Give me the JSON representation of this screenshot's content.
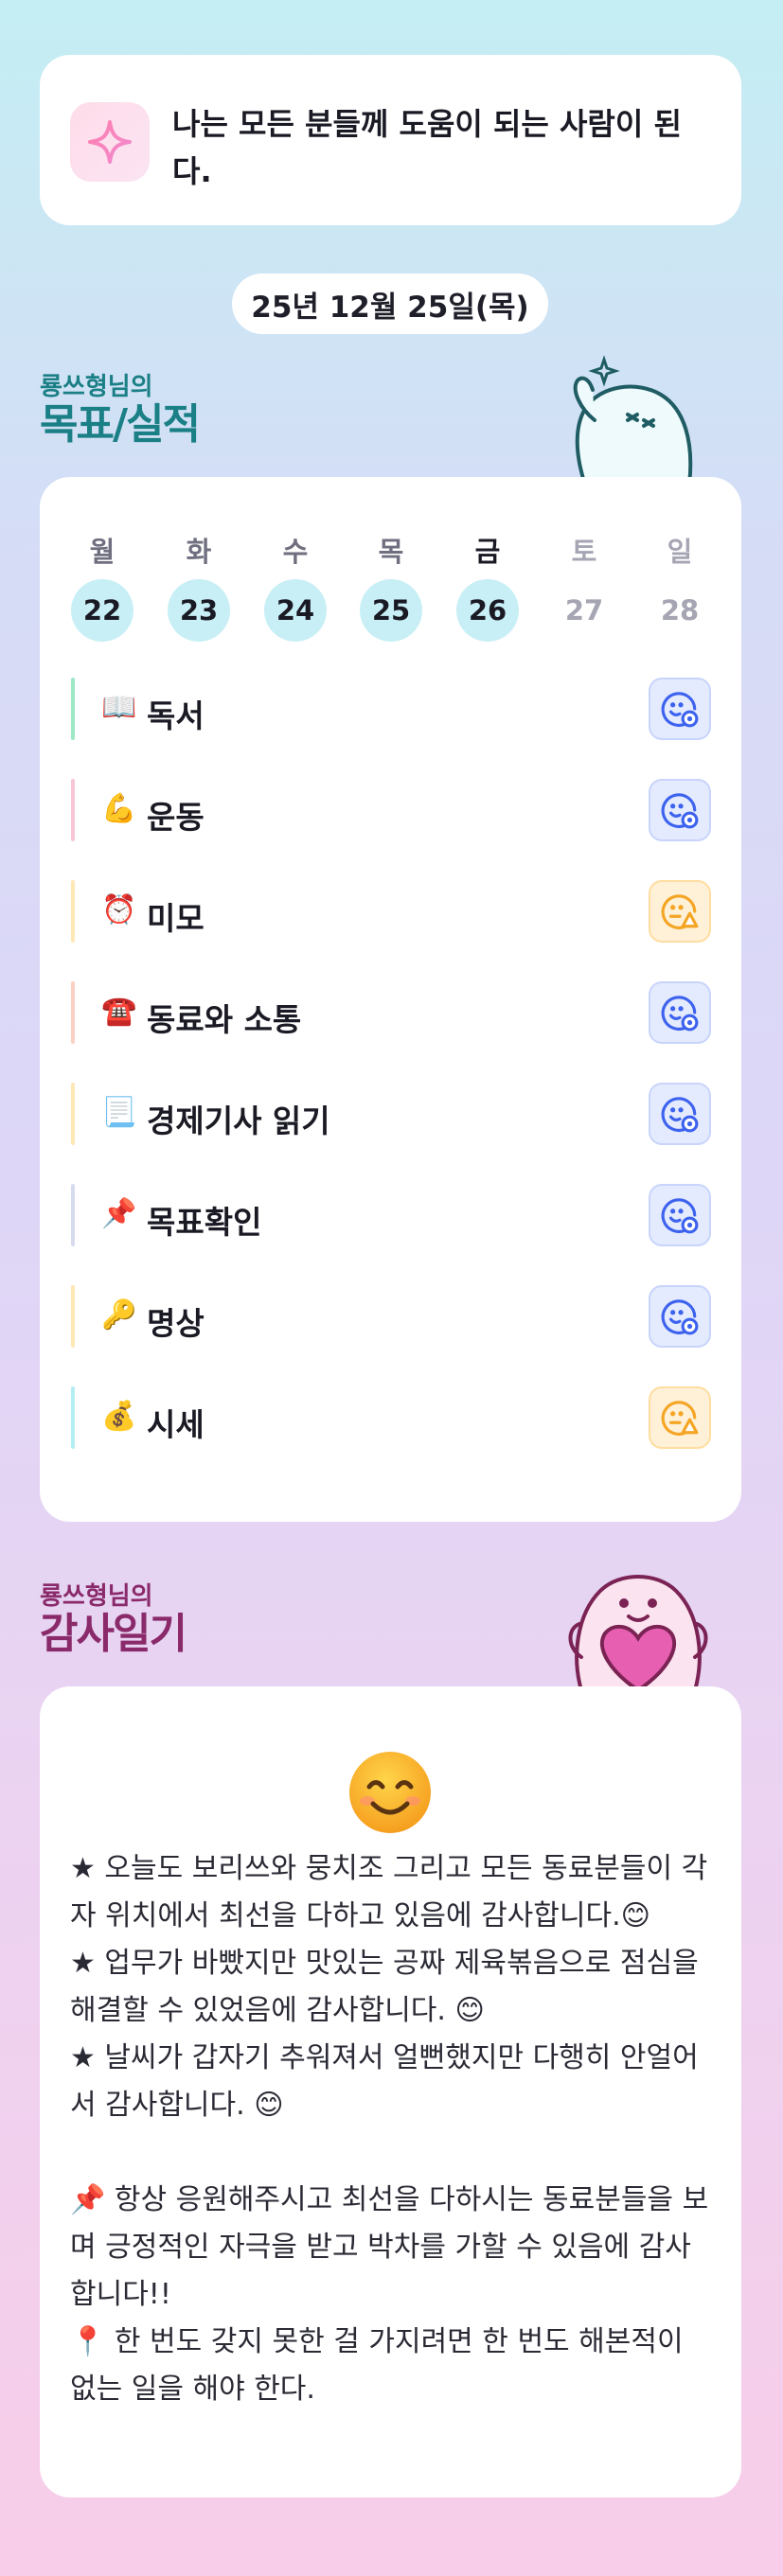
{
  "motto": {
    "icon": "sparkle-icon",
    "text": "나는 모든 분들께 도움이 되는 사람이 된다."
  },
  "date_label": "25년 12월 25일(목)",
  "goals_section": {
    "subtitle": "룡쓰형님의",
    "title": "목표/실적"
  },
  "week": {
    "days": [
      {
        "dow": "월",
        "num": "22",
        "filled": true
      },
      {
        "dow": "화",
        "num": "23",
        "filled": true
      },
      {
        "dow": "수",
        "num": "24",
        "filled": true
      },
      {
        "dow": "목",
        "num": "25",
        "filled": true
      },
      {
        "dow": "금",
        "num": "26",
        "filled": true
      },
      {
        "dow": "토",
        "num": "27",
        "filled": false
      },
      {
        "dow": "일",
        "num": "28",
        "filled": false
      }
    ]
  },
  "goals": [
    {
      "emoji": "📖",
      "name": "독서",
      "status": "done",
      "color": "#9ee7c7"
    },
    {
      "emoji": "💪",
      "name": "운동",
      "status": "done",
      "color": "#f9c6d7"
    },
    {
      "emoji": "⏰",
      "name": "미모",
      "status": "warn",
      "color": "#fde8b6"
    },
    {
      "emoji": "☎️",
      "name": "동료와 소통",
      "status": "done",
      "color": "#fbd0c4"
    },
    {
      "emoji": "📃",
      "name": "경제기사 읽기",
      "status": "done",
      "color": "#fde8b6"
    },
    {
      "emoji": "📌",
      "name": "목표확인",
      "status": "done",
      "color": "#d6dbf0"
    },
    {
      "emoji": "🔑",
      "name": "명상",
      "status": "done",
      "color": "#fde8b6"
    },
    {
      "emoji": "💰",
      "name": "시세",
      "status": "warn",
      "color": "#b5eef2"
    }
  ],
  "colors": {
    "done": "#3d63ee",
    "warn": "#f5a524",
    "goals_title": "#1b7f86",
    "grat_title": "#8a2a6a"
  },
  "gratitude_section": {
    "subtitle": "룡쓰형님의",
    "title": "감사일기"
  },
  "gratitude": {
    "emoji": "😊",
    "body": "★ 오늘도 보리쓰와 뭉치조 그리고 모든 동료분들이 각자 위치에서 최선을 다하고 있음에 감사합니다.😊\n★ 업무가 바빴지만 맛있는 공짜 제육볶음으로 점심을 해결할 수 있었음에 감사합니다. 😊\n★ 날씨가 갑자기 추워져서 얼뻔했지만 다행히 안얼어서 감사합니다. 😊\n\n📌 항상 응원해주시고 최선을 다하시는 동료분들을 보며 긍정적인 자극을 받고 박차를 가할 수 있음에 감사합니다!!\n📍 한 번도 갖지 못한 걸 가지려면 한 번도 해본적이 없는 일을 해야 한다."
  }
}
